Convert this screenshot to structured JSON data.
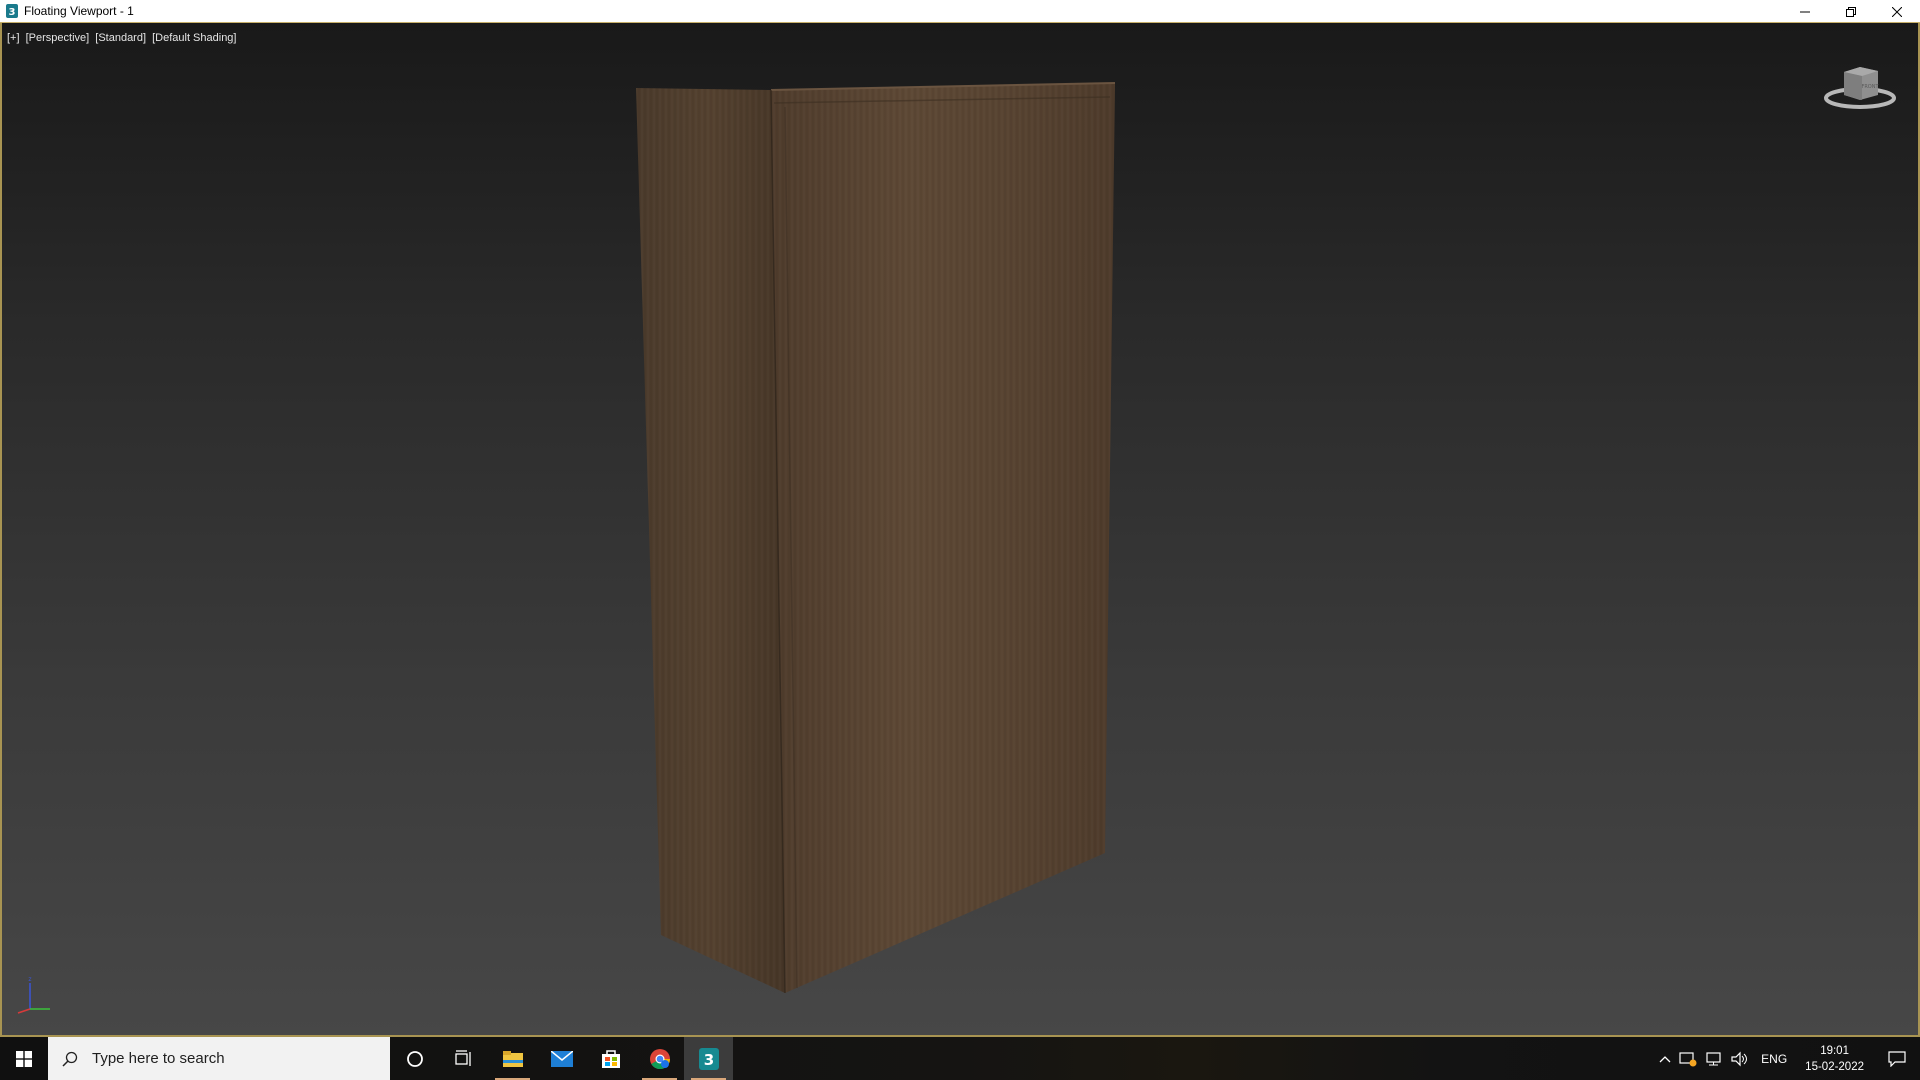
{
  "window": {
    "title": "Floating Viewport - 1",
    "icon": "3dsmax-icon"
  },
  "viewport": {
    "labels": [
      "[+]",
      "[Perspective]",
      "[Standard]",
      "[Default Shading]"
    ],
    "viewcube_face": "FRONT"
  },
  "taskbar": {
    "search_placeholder": "Type here to search",
    "apps": [
      "cortana-icon",
      "task-view-icon",
      "file-explorer-icon",
      "mail-icon",
      "store-icon",
      "chrome-icon",
      "3dsmax-icon"
    ],
    "tray_lang": "ENG",
    "time": "19:01",
    "date": "15-02-2022"
  },
  "colors": {
    "viewport_border": "#a89452",
    "wood_dark": "#4a3a2b",
    "wood_light": "#5a4634"
  }
}
